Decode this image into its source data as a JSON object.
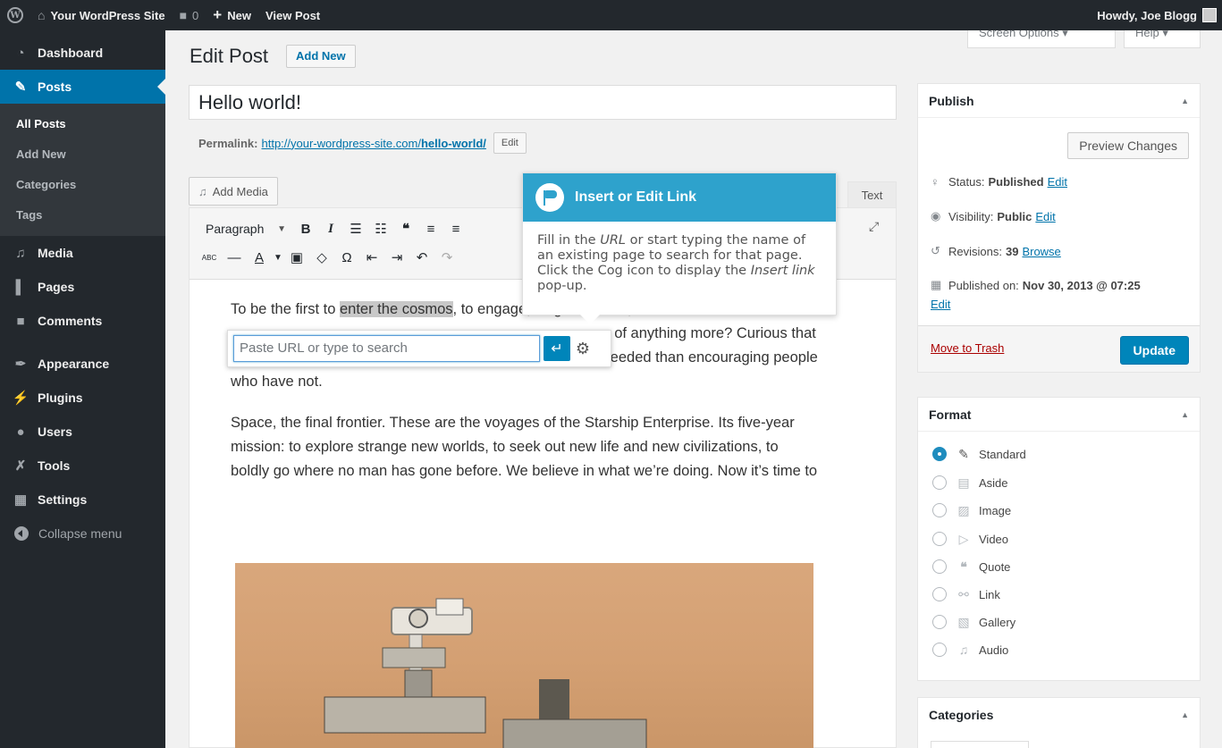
{
  "adminbar": {
    "site_name": "Your WordPress Site",
    "comments_count": "0",
    "new_label": "New",
    "view_post": "View Post",
    "howdy": "Howdy, Joe Blogg"
  },
  "sidebar": {
    "dashboard": "Dashboard",
    "posts": "Posts",
    "submenu": [
      "All Posts",
      "Add New",
      "Categories",
      "Tags"
    ],
    "media": "Media",
    "pages": "Pages",
    "comments": "Comments",
    "appearance": "Appearance",
    "plugins": "Plugins",
    "users": "Users",
    "tools": "Tools",
    "settings": "Settings",
    "collapse": "Collapse menu"
  },
  "top_tabs": {
    "screen_options": "Screen Options",
    "help": "Help"
  },
  "heading": {
    "title": "Edit Post",
    "add_new": "Add New"
  },
  "post": {
    "title": "Hello world!",
    "permalink_label": "Permalink:",
    "permalink_base": "http://your-wordpress-site.com/",
    "permalink_slug": "hello-world/",
    "permalink_edit": "Edit"
  },
  "editor": {
    "add_media": "Add Media",
    "text_tab": "Text",
    "format_select": "Paragraph",
    "p1_a": "To be the first to ",
    "p1_hl": "enter the cosmos",
    "p1_b": ", to engage, single-handed, in an",
    "p1_c": "u",
    "p1_d": "of anything more? Curious",
    "p1_e": "that we spend more time congratulating people who have succeeded than encouraging people who have not.",
    "p2": "Space, the final frontier. These are the voyages of the Starship Enterprise. Its five-year mission: to explore strange new worlds, to seek out new life and new civilizations, to boldly go where no man has gone before. We believe in what we’re doing. Now it’s time to"
  },
  "link_popup": {
    "placeholder": "Paste URL or type to search"
  },
  "pointer": {
    "title": "Insert or Edit Link",
    "body_1": "Fill in the ",
    "body_url": "URL",
    "body_2": " or start typing the name of an existing page to search for that page. Click the Cog icon to display the ",
    "body_insert": "Insert link",
    "body_3": " pop-up."
  },
  "publish": {
    "title": "Publish",
    "preview": "Preview Changes",
    "status_label": "Status:",
    "status_value": "Published",
    "visibility_label": "Visibility:",
    "visibility_value": "Public",
    "revisions_label": "Revisions:",
    "revisions_value": "39",
    "browse": "Browse",
    "published_label": "Published on:",
    "published_value": "Nov 30, 2013 @ 07:25",
    "edit": "Edit",
    "trash": "Move to Trash",
    "update": "Update"
  },
  "format": {
    "title": "Format",
    "selected": "Standard",
    "options": [
      "Standard",
      "Aside",
      "Image",
      "Video",
      "Quote",
      "Link",
      "Gallery",
      "Audio"
    ]
  },
  "categories": {
    "title": "Categories"
  }
}
